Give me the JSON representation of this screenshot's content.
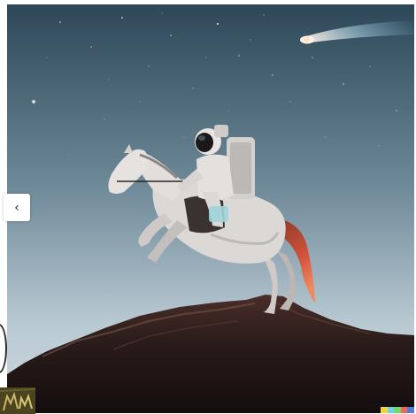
{
  "viewer": {
    "prev_button_glyph": "‹",
    "prev_icon": "chevron-left-icon"
  },
  "colors": {
    "sky_top": "#2d4758",
    "sky_mid": "#6f8a99",
    "sky_bottom": "#c6d4dc",
    "mountain_dark": "#1c1414",
    "mountain_ridge": "#6b4a40",
    "horse_body": "#dcd8d6",
    "tail": "#d2523c",
    "comet_core": "#fff4ea",
    "comet_trail": "#8fd0ea",
    "logo_bg": "#4c4420"
  },
  "watermark": {
    "colors": [
      "#f2d338",
      "#6fd0e8",
      "#6fd96b",
      "#ef6a54",
      "#5a7ad8"
    ]
  }
}
